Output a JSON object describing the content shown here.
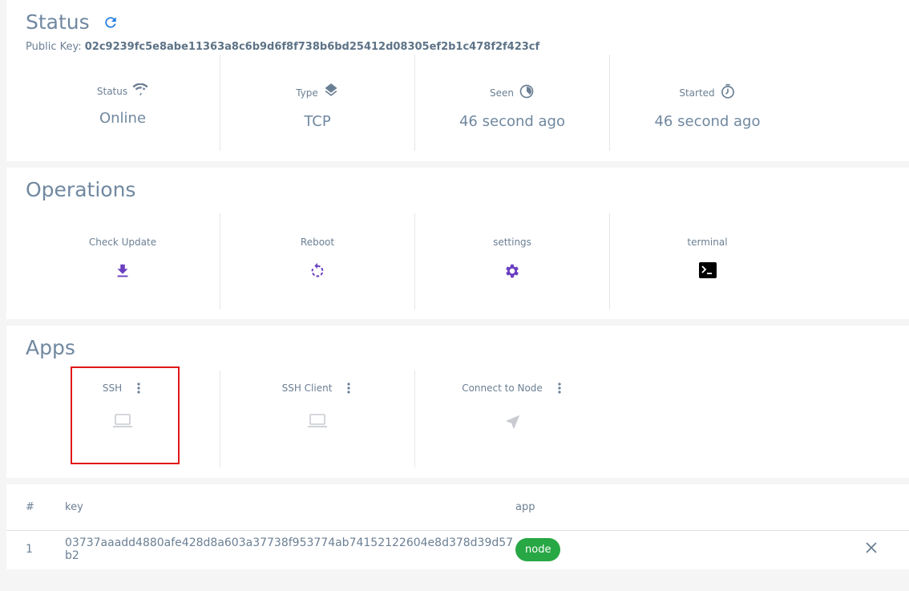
{
  "status": {
    "title": "Status",
    "refresh_icon": "refresh-icon",
    "public_key_label": "Public Key:",
    "public_key_value": "02c9239fc5e8abe11363a8c6b9d6f8f738b6bd25412d08305ef2b1c478f2f423cf",
    "items": [
      {
        "label": "Status",
        "icon": "wifi-icon",
        "value": "Online"
      },
      {
        "label": "Type",
        "icon": "layers-icon",
        "value": "TCP"
      },
      {
        "label": "Seen",
        "icon": "clock-pie-icon",
        "value": "46 second ago"
      },
      {
        "label": "Started",
        "icon": "timer-icon",
        "value": "46 second ago"
      }
    ]
  },
  "operations": {
    "title": "Operations",
    "items": [
      {
        "label": "Check Update",
        "icon": "download-icon",
        "color": "#6a3fc1"
      },
      {
        "label": "Reboot",
        "icon": "restart-icon",
        "color": "#6a3fc1"
      },
      {
        "label": "settings",
        "icon": "gear-icon",
        "color": "#6a3fc1"
      },
      {
        "label": "terminal",
        "icon": "terminal-icon",
        "color": "#000000"
      }
    ]
  },
  "apps": {
    "title": "Apps",
    "items": [
      {
        "label": "SSH",
        "icon": "laptop-icon"
      },
      {
        "label": "SSH Client",
        "icon": "laptop-icon"
      },
      {
        "label": "Connect to Node",
        "icon": "navigation-arrow-icon"
      }
    ]
  },
  "keys_table": {
    "headers": {
      "index": "#",
      "key": "key",
      "app": "app"
    },
    "rows": [
      {
        "index": "1",
        "key": "03737aaadd4880afe428d8a603a37738f953774ab74152122604e8d378d39d57b2",
        "app": "node",
        "badge_color": "#28a745"
      }
    ]
  }
}
